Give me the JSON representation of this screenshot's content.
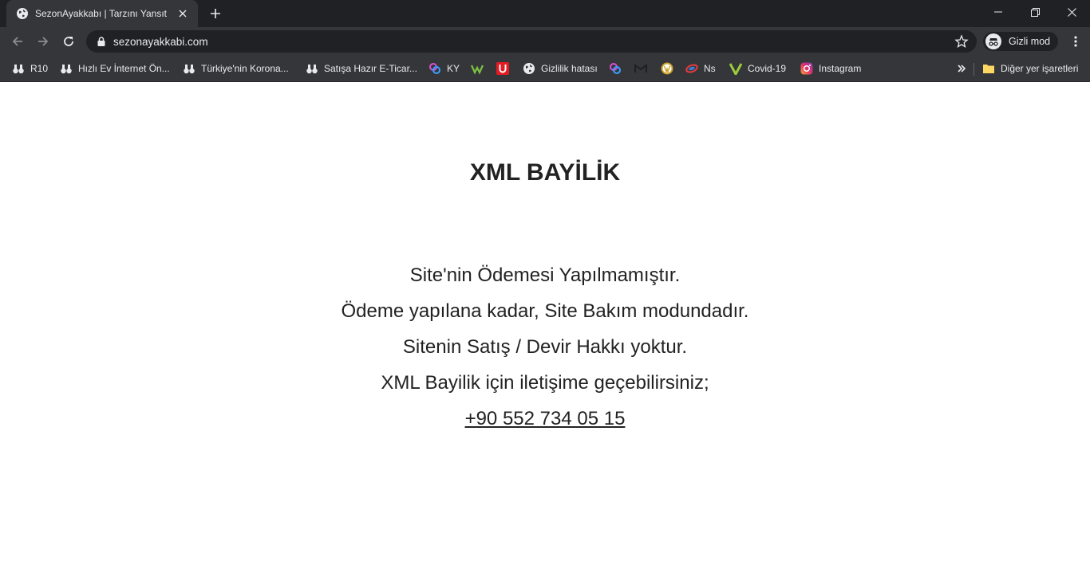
{
  "browser": {
    "tab": {
      "title": "SezonAyakkabı | Tarzını Yansıt"
    },
    "url": "sezonayakkabi.com",
    "incognito_label": "Gizli mod"
  },
  "bookmarks": {
    "items": [
      {
        "label": "R10",
        "icon": "binoculars-icon"
      },
      {
        "label": "Hızlı Ev İnternet Ön...",
        "icon": "binoculars-icon"
      },
      {
        "label": "Türkiye'nin Korona...",
        "icon": "binoculars-icon"
      },
      {
        "label": "Satışa Hazır E-Ticar...",
        "icon": "binoculars-icon"
      },
      {
        "label": "KY",
        "icon": "colorful-logo-icon"
      },
      {
        "label": "",
        "icon": "green-logo-icon"
      },
      {
        "label": "",
        "icon": "red-u-logo-icon"
      },
      {
        "label": "Gizlilik hatası",
        "icon": "globe-icon"
      },
      {
        "label": "",
        "icon": "colorful-logo-icon"
      },
      {
        "label": "",
        "icon": "gmail-icon"
      },
      {
        "label": "",
        "icon": "wordpress-icon"
      },
      {
        "label": "Ns",
        "icon": "ns-logo-icon"
      },
      {
        "label": "Covid-19",
        "icon": "v-logo-icon"
      },
      {
        "label": "Instagram",
        "icon": "instagram-icon"
      }
    ],
    "other_label": "Diğer yer işaretleri"
  },
  "page": {
    "heading": "XML BAYİLİK",
    "lines": [
      "Site'nin Ödemesi Yapılmamıştır.",
      "Ödeme yapılana kadar, Site Bakım modundadır.",
      "Sitenin Satış / Devir Hakkı yoktur.",
      "XML Bayilik için iletişime geçebilirsiniz;"
    ],
    "phone": "+90 552 734 05 15"
  },
  "colors": {
    "chrome_dark": "#202124",
    "chrome_toolbar": "#35363a",
    "chrome_text": "#e8eaed",
    "page_text": "#222222"
  }
}
